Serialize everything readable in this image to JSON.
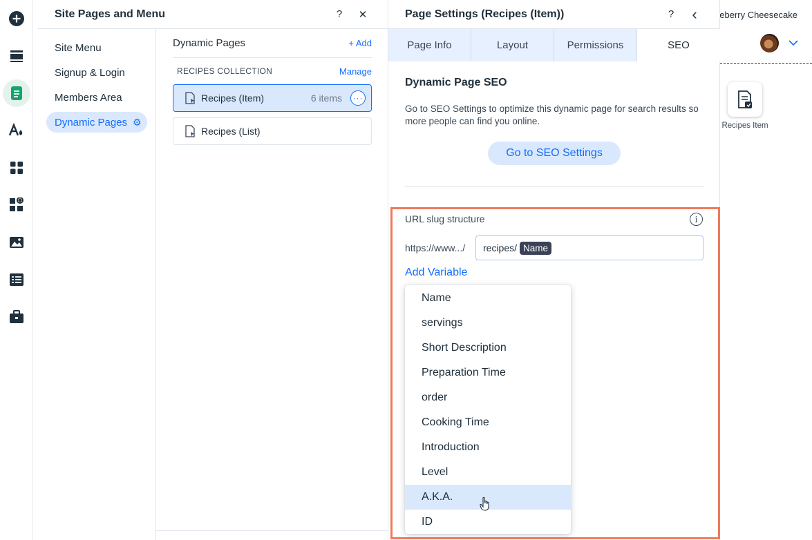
{
  "pages_panel": {
    "title": "Site Pages and Menu",
    "help": "?",
    "close": "✕",
    "nav": [
      {
        "label": "Site Menu"
      },
      {
        "label": "Signup & Login"
      },
      {
        "label": "Members Area"
      },
      {
        "label": "Dynamic Pages",
        "selected": true
      }
    ],
    "content_title": "Dynamic Pages",
    "add_label": "+ Add",
    "collection_title": "RECIPES COLLECTION",
    "manage_label": "Manage",
    "pages": [
      {
        "label": "Recipes (Item)",
        "count": "6 items",
        "selected": true
      },
      {
        "label": "Recipes (List)"
      }
    ]
  },
  "settings_panel": {
    "title": "Page Settings (Recipes (Item))",
    "help": "?",
    "back": "‹",
    "tabs": [
      "Page Info",
      "Layout",
      "Permissions",
      "SEO"
    ],
    "active_tab": "SEO",
    "seo_title": "Dynamic Page SEO",
    "seo_desc": "Go to SEO Settings to optimize this dynamic page for search results so more people can find you online.",
    "seo_button": "Go to SEO Settings",
    "slug_label": "URL slug structure",
    "url_prefix": "https://www.../",
    "slug_value": "recipes/",
    "slug_chip": "Name",
    "add_variable": "Add Variable",
    "variables": [
      "Name",
      "servings",
      "Short Description",
      "Preparation Time",
      "order",
      "Cooking Time",
      "Introduction",
      "Level",
      "A.K.A.",
      "ID"
    ],
    "hovered_variable": "A.K.A."
  },
  "preview": {
    "page_title": "ueberry Cheesecake",
    "recipe_label": "Recipes Item"
  },
  "colors": {
    "accent": "#116dff",
    "highlight": "#ee7a5c",
    "selected_bg": "#d9e8fd",
    "tab_bg": "#e7f0ff"
  }
}
